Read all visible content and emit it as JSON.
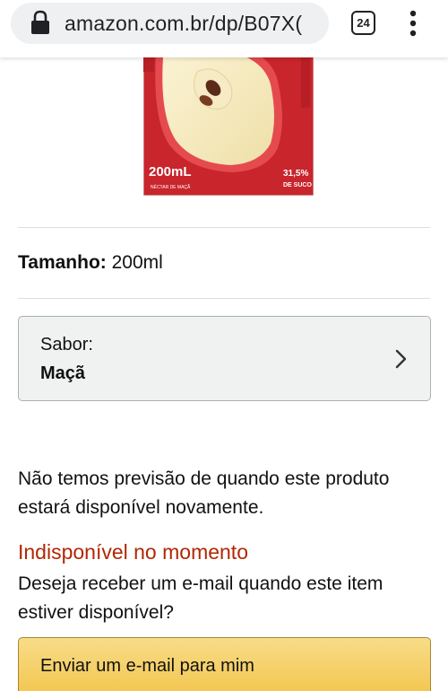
{
  "browser": {
    "url": "amazon.com.br/dp/B07X(",
    "tab_count": "24"
  },
  "product_image": {
    "volume_text": "200mL",
    "juice_percent_text": "31,5%",
    "juice_label_text": "DE SUCO",
    "small_text": "NÉCTAR DE MAÇÃ"
  },
  "size": {
    "label": "Tamanho:",
    "value": " 200ml"
  },
  "flavor": {
    "label": "Sabor:",
    "value": "Maçã"
  },
  "availability": {
    "note": "Não temos previsão de quando este produto estará disponível novamente.",
    "status": "Indisponível no momento",
    "question": "Deseja receber um e-mail quando este item estiver disponível?",
    "button_label": "Enviar um e-mail para mim"
  },
  "colors": {
    "unavailable": "#b12704",
    "button": "#f2c54b",
    "box_bg": "#f0f2f2"
  }
}
